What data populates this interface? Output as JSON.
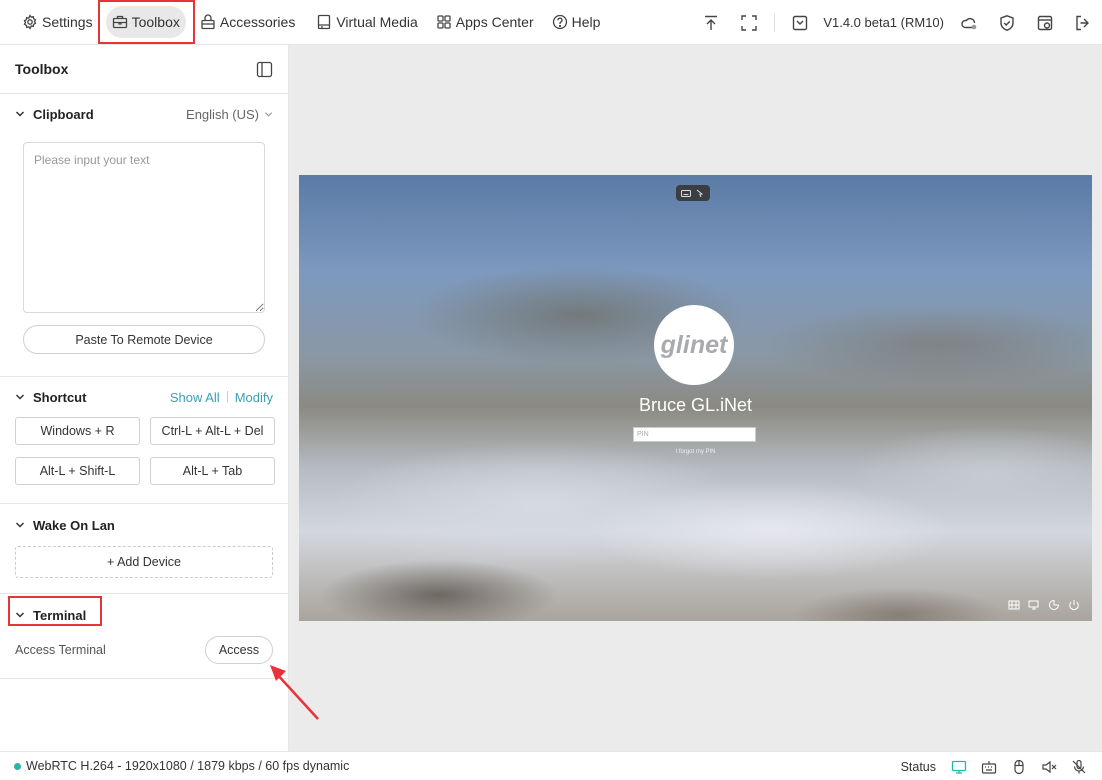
{
  "nav": {
    "items": [
      {
        "label": "Settings",
        "icon": "settings-icon"
      },
      {
        "label": "Toolbox",
        "icon": "toolbox-icon",
        "active": true
      },
      {
        "label": "Accessories",
        "icon": "accessories-icon"
      },
      {
        "label": "Virtual Media",
        "icon": "virtual-media-icon"
      },
      {
        "label": "Apps Center",
        "icon": "apps-center-icon"
      },
      {
        "label": "Help",
        "icon": "help-icon"
      }
    ],
    "version": "V1.4.0 beta1 (RM10)"
  },
  "sidebar": {
    "title": "Toolbox",
    "clipboard": {
      "title": "Clipboard",
      "language": "English (US)",
      "placeholder": "Please input your text",
      "paste_button": "Paste To Remote Device"
    },
    "shortcut": {
      "title": "Shortcut",
      "show_all": "Show All",
      "modify": "Modify",
      "buttons": [
        "Windows + R",
        "Ctrl-L + Alt-L + Del",
        "Alt-L + Shift-L",
        "Alt-L + Tab"
      ]
    },
    "wake_on_lan": {
      "title": "Wake On Lan",
      "add_device": "+ Add Device"
    },
    "terminal": {
      "title": "Terminal",
      "label": "Access Terminal",
      "button": "Access"
    }
  },
  "remote_screen": {
    "avatar_text": "glinet",
    "user_name": "Bruce GL.iNet",
    "pin_placeholder": "PIN",
    "forgot_pin": "I forgot my PIN"
  },
  "statusbar": {
    "stream_info": "WebRTC H.264 - 1920x1080 / 1879 kbps / 60 fps dynamic",
    "status_label": "Status"
  },
  "colors": {
    "accent_link": "#3aa0b5",
    "status_dot": "#28b5a8",
    "highlight_red": "#e8333a",
    "active_nav_bg": "#e8e8e8"
  }
}
